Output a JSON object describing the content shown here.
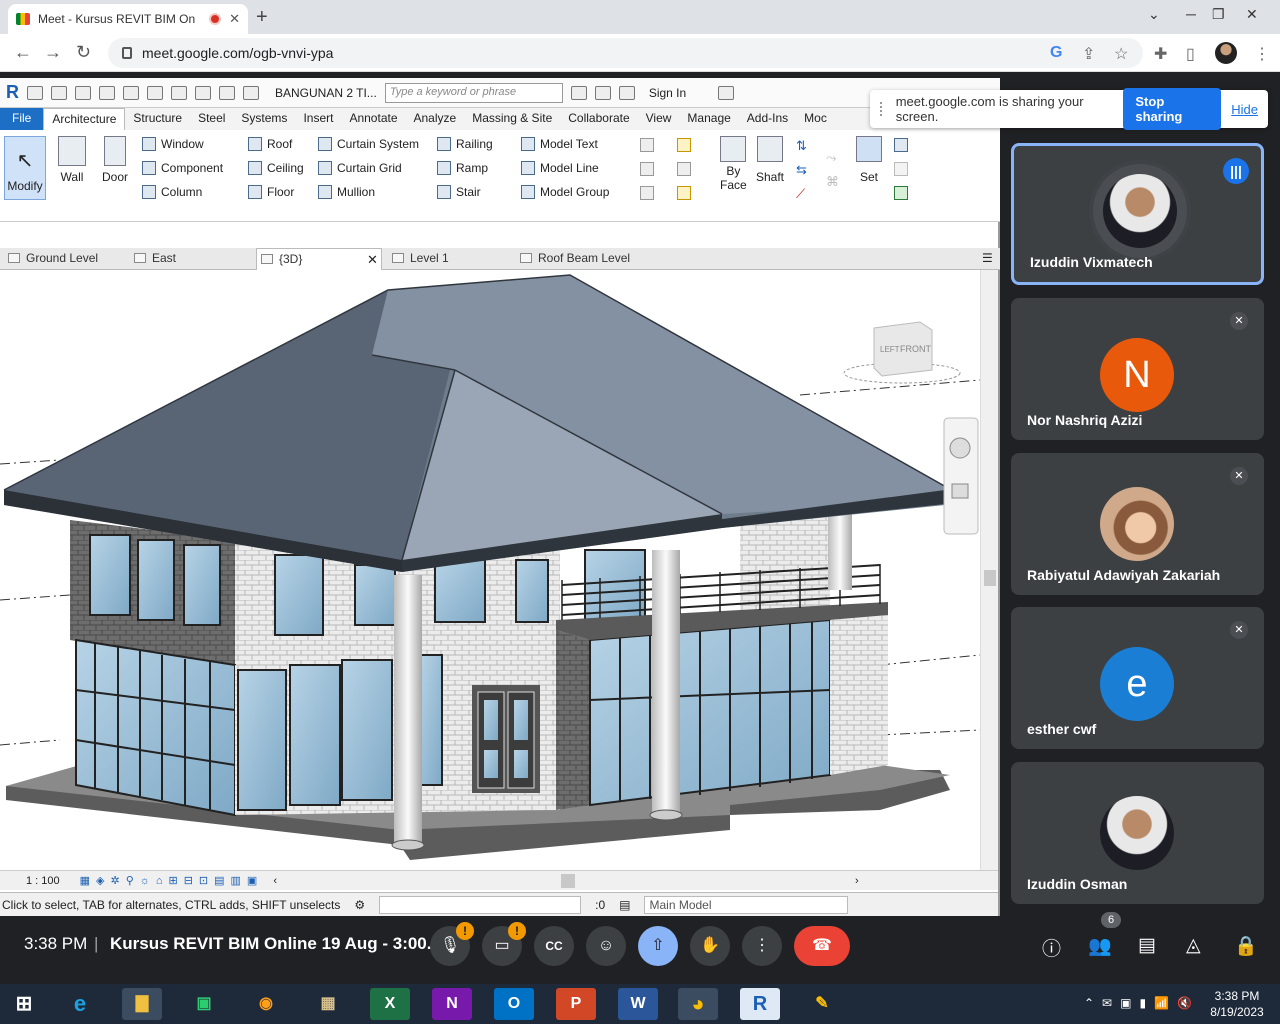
{
  "browser": {
    "tab_title": "Meet - Kursus REVIT BIM On",
    "new_tab": "+",
    "url": "meet.google.com/ogb-vnvi-ypa"
  },
  "revit": {
    "doc_title": "BANGUNAN 2 TI...",
    "search_placeholder": "Type a keyword or phrase",
    "sign_in": "Sign In",
    "ribbon_tabs": [
      "File",
      "Architecture",
      "Structure",
      "Steel",
      "Systems",
      "Insert",
      "Annotate",
      "Analyze",
      "Massing & Site",
      "Collaborate",
      "View",
      "Manage",
      "Add-Ins",
      "Moc"
    ],
    "tools": {
      "modify": "Modify",
      "wall": "Wall",
      "door": "Door",
      "window": "Window",
      "component": "Component",
      "column": "Column",
      "roof": "Roof",
      "ceiling": "Ceiling",
      "floor": "Floor",
      "curtain_system": "Curtain System",
      "curtain_grid": "Curtain Grid",
      "mullion": "Mullion",
      "railing": "Railing",
      "ramp": "Ramp",
      "stair": "Stair",
      "model_text": "Model Text",
      "model_line": "Model Line",
      "model_group": "Model Group",
      "by_face_1": "By",
      "by_face_2": "Face",
      "shaft": "Shaft",
      "set": "Set"
    },
    "view_tabs": [
      "Ground Level",
      "East",
      "{3D}",
      "Level 1",
      "Roof Beam Level"
    ],
    "viewcube_left": "LEFT",
    "viewcube_front": "FRONT",
    "scale": "1 : 100",
    "status_text": "Click to select, TAB for alternates, CTRL adds, SHIFT unselects",
    "filter_count": ":0",
    "main_model": "Main Model"
  },
  "banner": {
    "message": "meet.google.com is sharing your screen.",
    "stop": "Stop sharing",
    "hide": "Hide"
  },
  "participants": [
    {
      "name": "Izuddin Vixmatech"
    },
    {
      "name": "Nor Nashriq Azizi",
      "initial": "N",
      "color": "#e8590c"
    },
    {
      "name": "Rabiyatul Adawiyah Zakariah"
    },
    {
      "name": "esther cwf",
      "initial": "e",
      "color": "#1a7fd4"
    },
    {
      "name": "Izuddin Osman"
    }
  ],
  "meet": {
    "time": "3:38 PM",
    "separator": "|",
    "meeting_title": "Kursus REVIT BIM Online 19 Aug - 3:00...",
    "participant_count": "6"
  },
  "taskbar": {
    "time": "3:38 PM",
    "date": "8/19/2023",
    "apps": [
      "X",
      "N",
      "O",
      "P",
      "W",
      "R"
    ]
  }
}
